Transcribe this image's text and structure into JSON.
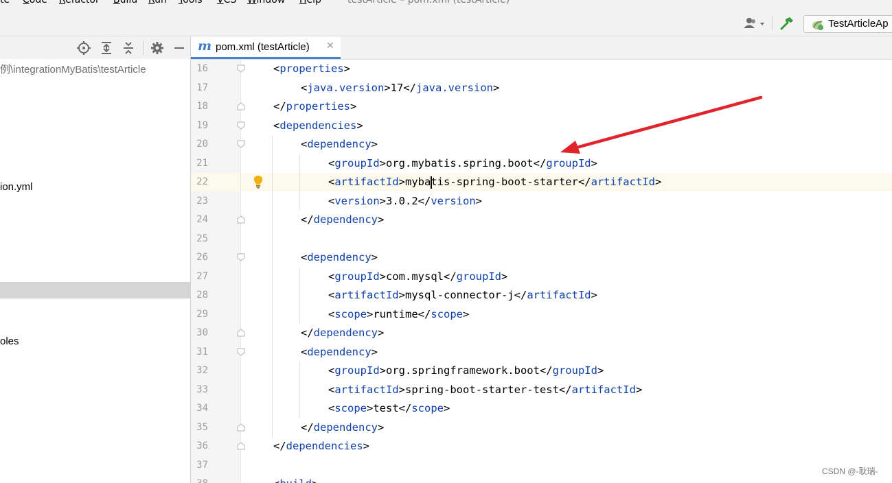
{
  "menu": {
    "items": [
      "te",
      "Code",
      "Refactor",
      "Build",
      "Run",
      "Tools",
      "VCS",
      "Window",
      "Help"
    ],
    "window_title": "testArticle – pom.xml (testArticle)"
  },
  "toolbar": {
    "user_icon": "user-dropdown-icon",
    "build_icon": "hammer-icon",
    "run_config_label": "TestArticleAp"
  },
  "project_panel": {
    "path": "例\\integrationMyBatis\\testArticle",
    "items": [
      "ion.yml",
      "oles"
    ],
    "header_icons": [
      "locate-icon",
      "expand-all-icon",
      "collapse-all-icon",
      "gear-icon",
      "minimize-icon"
    ]
  },
  "editor_tab": {
    "icon": "m",
    "name": "pom.xml (testArticle)",
    "close": "✕"
  },
  "editor": {
    "lines": [
      {
        "n": "16",
        "indent": 1,
        "parts": [
          [
            "p",
            "<"
          ],
          [
            "t",
            "properties"
          ],
          [
            "p",
            ">"
          ]
        ]
      },
      {
        "n": "17",
        "indent": 2,
        "parts": [
          [
            "p",
            "<"
          ],
          [
            "t",
            "java.version"
          ],
          [
            "p",
            ">17</"
          ],
          [
            "t",
            "java.version"
          ],
          [
            "p",
            ">"
          ]
        ]
      },
      {
        "n": "18",
        "indent": 1,
        "parts": [
          [
            "p",
            "</"
          ],
          [
            "t",
            "properties"
          ],
          [
            "p",
            ">"
          ]
        ]
      },
      {
        "n": "19",
        "indent": 1,
        "parts": [
          [
            "p",
            "<"
          ],
          [
            "t",
            "dependencies"
          ],
          [
            "p",
            ">"
          ]
        ]
      },
      {
        "n": "20",
        "indent": 2,
        "parts": [
          [
            "p",
            "<"
          ],
          [
            "t",
            "dependency"
          ],
          [
            "p",
            ">"
          ]
        ]
      },
      {
        "n": "21",
        "indent": 3,
        "parts": [
          [
            "p",
            "<"
          ],
          [
            "t",
            "groupId"
          ],
          [
            "p",
            ">org.mybatis.spring.boot</"
          ],
          [
            "t",
            "groupId"
          ],
          [
            "p",
            ">"
          ]
        ]
      },
      {
        "n": "22",
        "indent": 3,
        "parts": [
          [
            "p",
            "<"
          ],
          [
            "t",
            "artifactId"
          ],
          [
            "p",
            ">mybatis-spring-boot-starter</"
          ],
          [
            "t",
            "artifactId"
          ],
          [
            "p",
            ">"
          ]
        ]
      },
      {
        "n": "23",
        "indent": 3,
        "parts": [
          [
            "p",
            "<"
          ],
          [
            "t",
            "version"
          ],
          [
            "p",
            ">3.0.2</"
          ],
          [
            "t",
            "version"
          ],
          [
            "p",
            ">"
          ]
        ]
      },
      {
        "n": "24",
        "indent": 2,
        "parts": [
          [
            "p",
            "</"
          ],
          [
            "t",
            "dependency"
          ],
          [
            "p",
            ">"
          ]
        ]
      },
      {
        "n": "25",
        "indent": 0,
        "parts": []
      },
      {
        "n": "26",
        "indent": 2,
        "parts": [
          [
            "p",
            "<"
          ],
          [
            "t",
            "dependency"
          ],
          [
            "p",
            ">"
          ]
        ]
      },
      {
        "n": "27",
        "indent": 3,
        "parts": [
          [
            "p",
            "<"
          ],
          [
            "t",
            "groupId"
          ],
          [
            "p",
            ">com.mysql</"
          ],
          [
            "t",
            "groupId"
          ],
          [
            "p",
            ">"
          ]
        ]
      },
      {
        "n": "28",
        "indent": 3,
        "parts": [
          [
            "p",
            "<"
          ],
          [
            "t",
            "artifactId"
          ],
          [
            "p",
            ">mysql-connector-j</"
          ],
          [
            "t",
            "artifactId"
          ],
          [
            "p",
            ">"
          ]
        ]
      },
      {
        "n": "29",
        "indent": 3,
        "parts": [
          [
            "p",
            "<"
          ],
          [
            "t",
            "scope"
          ],
          [
            "p",
            ">runtime</"
          ],
          [
            "t",
            "scope"
          ],
          [
            "p",
            ">"
          ]
        ]
      },
      {
        "n": "30",
        "indent": 2,
        "parts": [
          [
            "p",
            "</"
          ],
          [
            "t",
            "dependency"
          ],
          [
            "p",
            ">"
          ]
        ]
      },
      {
        "n": "31",
        "indent": 2,
        "parts": [
          [
            "p",
            "<"
          ],
          [
            "t",
            "dependency"
          ],
          [
            "p",
            ">"
          ]
        ]
      },
      {
        "n": "32",
        "indent": 3,
        "parts": [
          [
            "p",
            "<"
          ],
          [
            "t",
            "groupId"
          ],
          [
            "p",
            ">org.springframework.boot</"
          ],
          [
            "t",
            "groupId"
          ],
          [
            "p",
            ">"
          ]
        ]
      },
      {
        "n": "33",
        "indent": 3,
        "parts": [
          [
            "p",
            "<"
          ],
          [
            "t",
            "artifactId"
          ],
          [
            "p",
            ">spring-boot-starter-test</"
          ],
          [
            "t",
            "artifactId"
          ],
          [
            "p",
            ">"
          ]
        ]
      },
      {
        "n": "34",
        "indent": 3,
        "parts": [
          [
            "p",
            "<"
          ],
          [
            "t",
            "scope"
          ],
          [
            "p",
            ">test</"
          ],
          [
            "t",
            "scope"
          ],
          [
            "p",
            ">"
          ]
        ]
      },
      {
        "n": "35",
        "indent": 2,
        "parts": [
          [
            "p",
            "</"
          ],
          [
            "t",
            "dependency"
          ],
          [
            "p",
            ">"
          ]
        ]
      },
      {
        "n": "36",
        "indent": 1,
        "parts": [
          [
            "p",
            "</"
          ],
          [
            "t",
            "dependencies"
          ],
          [
            "p",
            ">"
          ]
        ]
      },
      {
        "n": "37",
        "indent": 0,
        "parts": []
      },
      {
        "n": "38",
        "indent": 1,
        "parts": [
          [
            "p",
            "<"
          ],
          [
            "t",
            "build"
          ],
          [
            "p",
            ">"
          ]
        ]
      }
    ],
    "current_line": "22",
    "intention_icon": "lightbulb-icon"
  },
  "annotation": {
    "type": "red-arrow",
    "color": "#e0242b"
  },
  "watermark": "CSDN @-耿瑞-",
  "colors": {
    "tag": "#0f3fa8",
    "line_number": "#9e9e9e",
    "current_line_bg": "#fcfaed",
    "tab_underline": "#4083c9"
  }
}
